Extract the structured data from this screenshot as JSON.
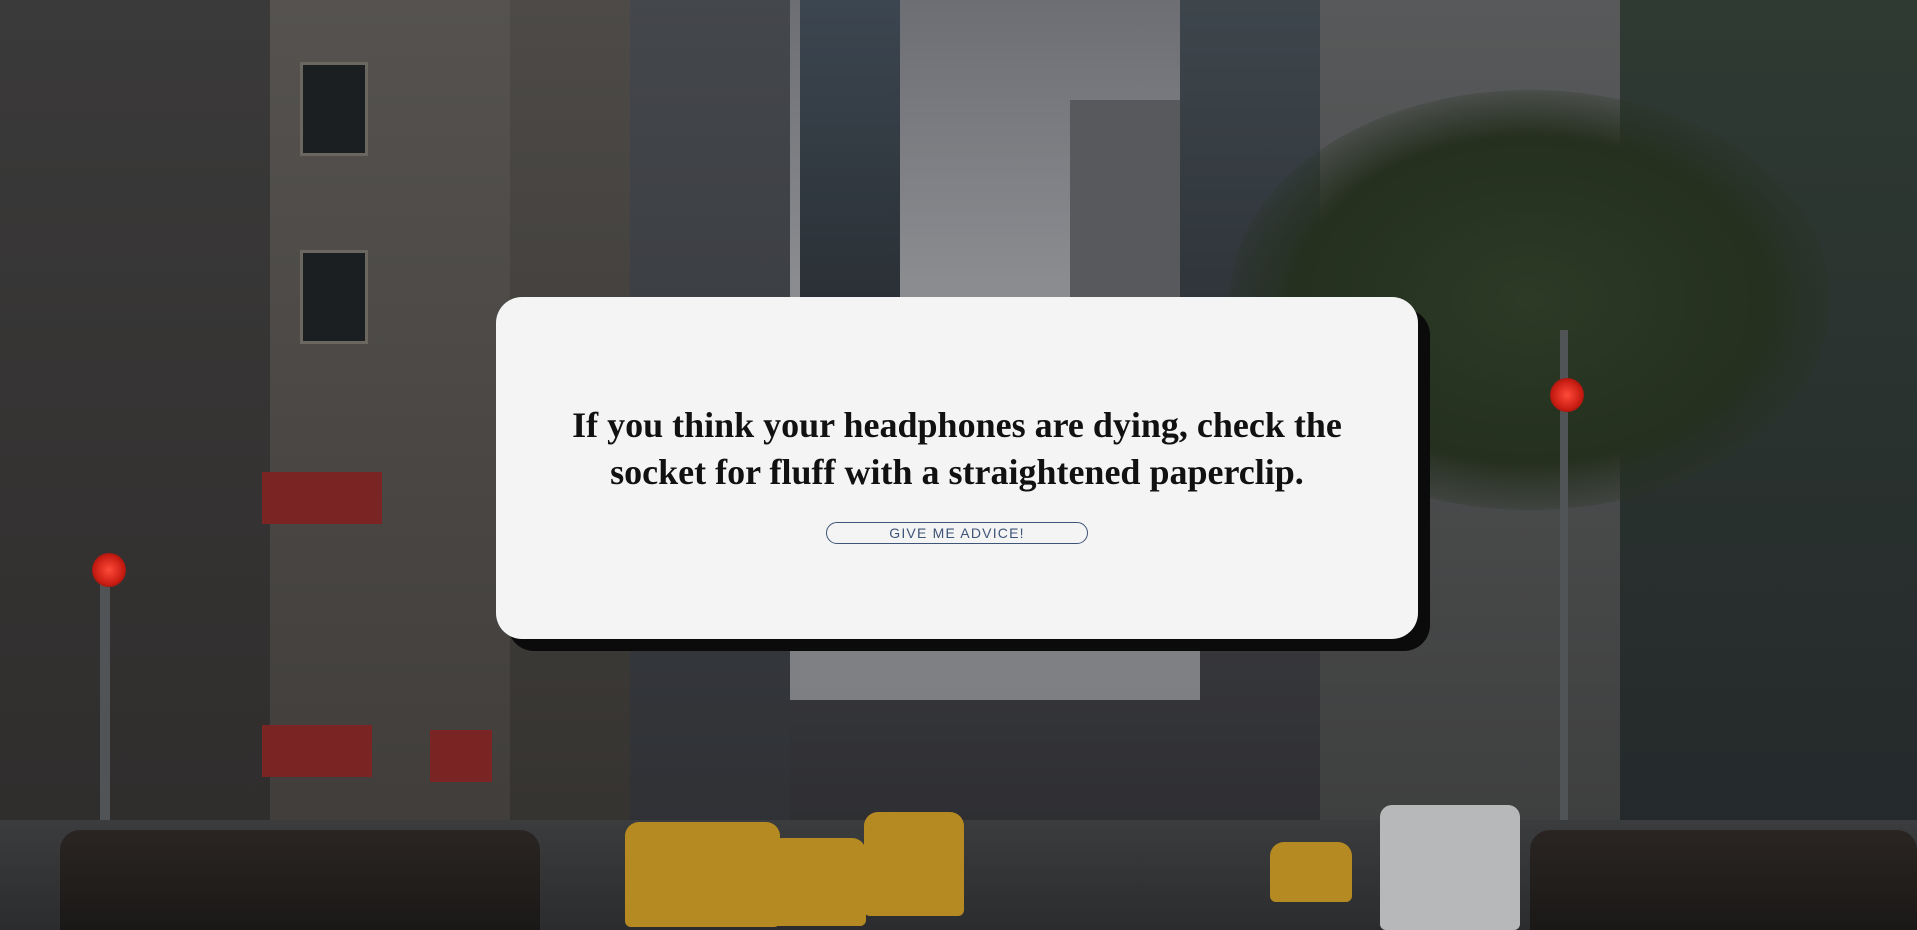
{
  "advice": {
    "text": "If you think your headphones are dying, check the socket for fluff with a straightened paperclip."
  },
  "button": {
    "label": "GIVE ME ADVICE!"
  },
  "colors": {
    "card_background": "#f4f4f4",
    "card_shadow": "#0b0b0b",
    "button_accent": "#3e5478",
    "text": "#111111"
  },
  "background": {
    "scene": "city-street-photo"
  }
}
